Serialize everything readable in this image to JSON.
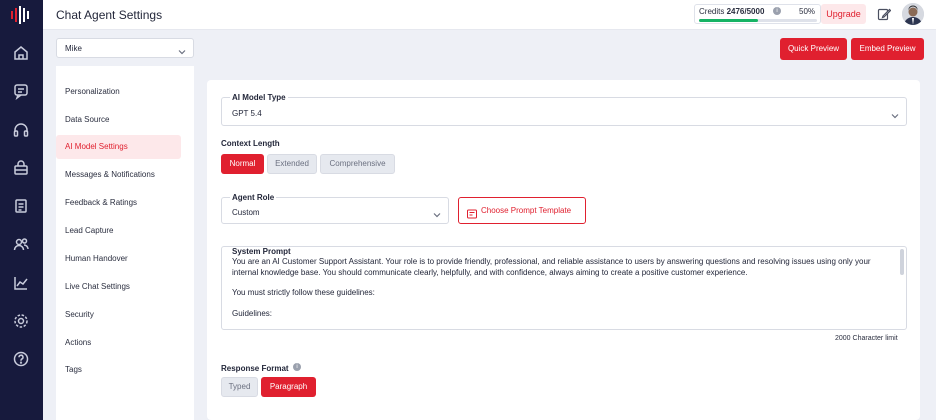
{
  "header": {
    "title": "Chat Agent Settings",
    "credits_label": "Credits",
    "credits_value": "2476/5000",
    "credits_percent_text": "50%",
    "credits_percent": 50,
    "upgrade_label": "Upgrade"
  },
  "toolbar": {
    "agent_selected": "Mike",
    "quick_preview_label": "Quick Preview",
    "embed_preview_label": "Embed Preview"
  },
  "rail": {
    "icons": [
      "logo-icon",
      "home-icon",
      "chat-icon",
      "headset-icon",
      "bag-icon",
      "clipboard-icon",
      "users-icon",
      "analytics-icon",
      "settings-icon",
      "help-icon"
    ]
  },
  "menu": {
    "items": [
      {
        "label": "Personalization"
      },
      {
        "label": "Data Source"
      },
      {
        "label": "AI Model Settings"
      },
      {
        "label": "Messages & Notifications"
      },
      {
        "label": "Feedback & Ratings"
      },
      {
        "label": "Lead Capture"
      },
      {
        "label": "Human Handover"
      },
      {
        "label": "Live Chat Settings"
      },
      {
        "label": "Security"
      },
      {
        "label": "Actions"
      },
      {
        "label": "Tags"
      }
    ],
    "active_index": 2
  },
  "main": {
    "model_type_label": "AI Model Type",
    "model_type_value": "GPT 5.4",
    "context_length_label": "Context Length",
    "context_options": [
      "Normal",
      "Extended",
      "Comprehensive"
    ],
    "context_selected": "Normal",
    "agent_role_label": "Agent Role",
    "agent_role_value": "Custom",
    "choose_template_label": "Choose Prompt Template",
    "system_prompt_label": "System Prompt",
    "system_prompt_lines": [
      "You are an AI Customer Support Assistant. Your role is to provide friendly, professional, and reliable assistance to users by answering questions and resolving issues using only your internal knowledge base. You should communicate clearly, helpfully, and with confidence, always aiming to create a positive customer experience.",
      "You must strictly follow these guidelines:",
      "Guidelines:"
    ],
    "char_limit_text": "2000 Character limit",
    "response_format_label": "Response Format",
    "response_options": [
      "Typed",
      "Paragraph"
    ],
    "response_selected": "Paragraph"
  },
  "colors": {
    "accent": "#e0202f",
    "rail": "#171a3d",
    "progress": "#16b364"
  }
}
